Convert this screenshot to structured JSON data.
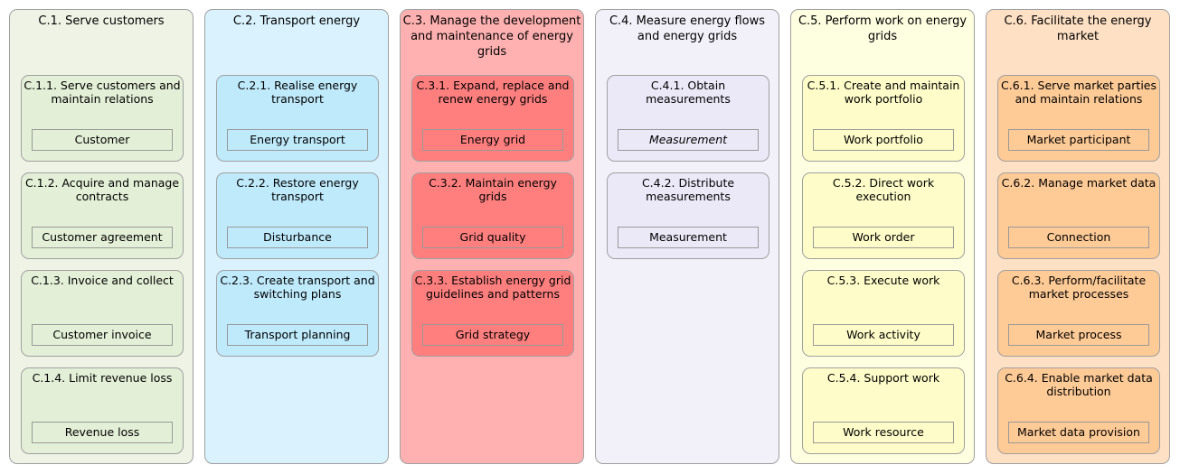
{
  "columns": [
    {
      "title": "C.1. Serve customers",
      "bg": "#eef3e6",
      "inner": "#e4efd7",
      "capabilities": [
        {
          "title": "C.1.1. Serve customers and maintain relations",
          "entity": "Customer"
        },
        {
          "title": "C.1.2. Acquire and manage contracts",
          "entity": "Customer agreement"
        },
        {
          "title": "C.1.3. Invoice and collect",
          "entity": "Customer invoice"
        },
        {
          "title": "C.1.4. Limit revenue loss",
          "entity": "Revenue loss"
        }
      ]
    },
    {
      "title": "C.2. Transport energy",
      "bg": "#d9f2fd",
      "inner": "#bfeafc",
      "capabilities": [
        {
          "title": "C.2.1. Realise energy transport",
          "entity": "Energy transport"
        },
        {
          "title": "C.2.2. Restore energy transport",
          "entity": "Disturbance"
        },
        {
          "title": "C.2.3. Create transport and switching plans",
          "entity": "Transport planning"
        }
      ]
    },
    {
      "title": "C.3. Manage the development and maintenance of energy grids",
      "bg": "#ffb1b1",
      "inner": "#ff7f7f",
      "capabilities": [
        {
          "title": "C.3.1. Expand, replace and renew energy grids",
          "entity": "Energy grid"
        },
        {
          "title": "C.3.2. Maintain energy grids",
          "entity": "Grid quality"
        },
        {
          "title": "C.3.3. Establish energy grid guidelines and patterns",
          "entity": "Grid strategy"
        }
      ]
    },
    {
      "title": "C.4. Measure energy flows and energy grids",
      "bg": "#f2f1fa",
      "inner": "#ebe9f7",
      "capabilities": [
        {
          "title": "C.4.1. Obtain measurements",
          "entity": "Measurement",
          "italic": true
        },
        {
          "title": "C.4.2. Distribute measurements",
          "entity": "Measurement"
        }
      ]
    },
    {
      "title": "C.5. Perform work on energy grids",
      "bg": "#fefee1",
      "inner": "#fefdc9",
      "capabilities": [
        {
          "title": "C.5.1. Create and maintain work portfolio",
          "entity": "Work portfolio"
        },
        {
          "title": "C.5.2. Direct work execution",
          "entity": "Work order"
        },
        {
          "title": "C.5.3. Execute work",
          "entity": "Work activity"
        },
        {
          "title": "C.5.4. Support work",
          "entity": "Work resource"
        }
      ]
    },
    {
      "title": "C.6. Facilitate the energy market",
      "bg": "#fee0c4",
      "inner": "#feca96",
      "capabilities": [
        {
          "title": "C.6.1. Serve market parties and maintain relations",
          "entity": "Market participant"
        },
        {
          "title": "C.6.2. Manage market data",
          "entity": "Connection"
        },
        {
          "title": "C.6.3. Perform/facilitate market processes",
          "entity": "Market process"
        },
        {
          "title": "C.6.4. Enable market data distribution",
          "entity": "Market data provision"
        }
      ]
    }
  ]
}
